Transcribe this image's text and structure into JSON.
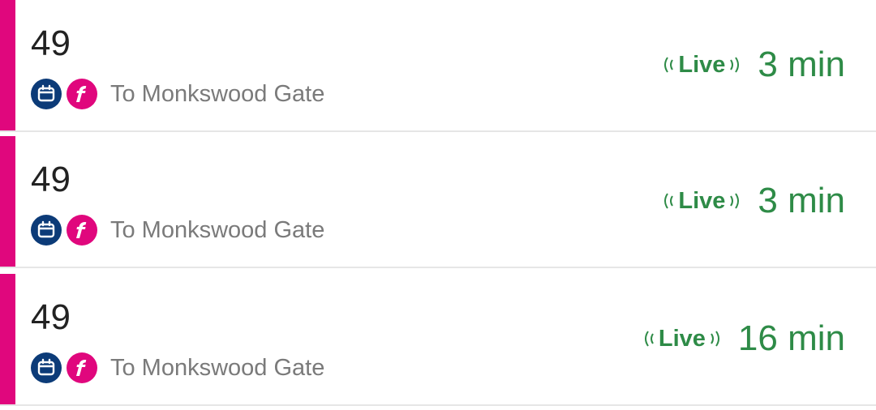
{
  "colors": {
    "accent": "#e0077d",
    "live_green": "#2e8b47",
    "timetable_icon_bg": "#0c3b78",
    "operator_icon_bg": "#e0077d",
    "route_text": "#222222",
    "destination_text": "#7a7a7a"
  },
  "departures": [
    {
      "route": "49",
      "destination": "To Monkswood Gate",
      "live_label": "Live",
      "time": "3 min",
      "icons": [
        "calendar-timetable-icon",
        "operator-logo-icon"
      ]
    },
    {
      "route": "49",
      "destination": "To Monkswood Gate",
      "live_label": "Live",
      "time": "3 min",
      "icons": [
        "calendar-timetable-icon",
        "operator-logo-icon"
      ]
    },
    {
      "route": "49",
      "destination": "To Monkswood Gate",
      "live_label": "Live",
      "time": "16 min",
      "icons": [
        "calendar-timetable-icon",
        "operator-logo-icon"
      ]
    }
  ]
}
